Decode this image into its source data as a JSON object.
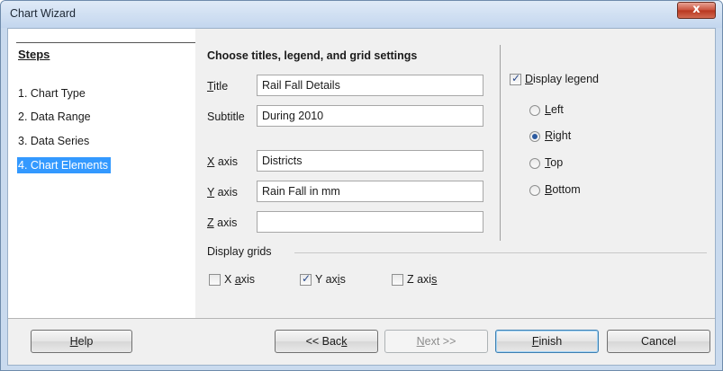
{
  "window": {
    "title": "Chart Wizard",
    "close_glyph": "x"
  },
  "sidebar": {
    "heading": "Steps",
    "steps": [
      {
        "label": "1. Chart Type"
      },
      {
        "label": "2. Data Range"
      },
      {
        "label": "3. Data Series"
      },
      {
        "label": "4. Chart Elements",
        "active": true
      }
    ]
  },
  "main": {
    "heading": "Choose titles, legend, and grid settings",
    "fields": {
      "title": {
        "label_u": "T",
        "label_rest": "itle",
        "value": "Rail Fall Details"
      },
      "subtitle": {
        "label": "Subtitle",
        "value": "During 2010"
      },
      "x_axis": {
        "label_u": "X",
        "label_rest": " axis",
        "value": "Districts"
      },
      "y_axis": {
        "label_u": "Y",
        "label_rest": " axis",
        "value": "Rain Fall in mm"
      },
      "z_axis": {
        "label_u": "Z",
        "label_rest": " axis",
        "value": ""
      }
    },
    "legend": {
      "display_u": "D",
      "display_rest": "isplay legend",
      "display_checked": true,
      "options": [
        {
          "u": "L",
          "rest": "eft"
        },
        {
          "u": "R",
          "rest": "ight",
          "checked": true
        },
        {
          "u": "T",
          "rest": "op"
        },
        {
          "u": "B",
          "rest": "ottom"
        }
      ]
    },
    "grids": {
      "heading": "Display grids",
      "x": {
        "pre": "X ",
        "u": "a",
        "post": "xis",
        "checked": false
      },
      "y": {
        "pre": "Y ax",
        "u": "i",
        "post": "s",
        "checked": true
      },
      "z": {
        "pre": "Z axi",
        "u": "s",
        "post": "",
        "checked": false
      }
    }
  },
  "buttons": {
    "help": {
      "u": "H",
      "rest": "elp"
    },
    "back": {
      "pre": "<< Bac",
      "u": "k"
    },
    "next": {
      "u": "N",
      "rest": "ext >>"
    },
    "finish": {
      "u": "F",
      "rest": "inish"
    },
    "cancel": {
      "label": "Cancel"
    }
  }
}
